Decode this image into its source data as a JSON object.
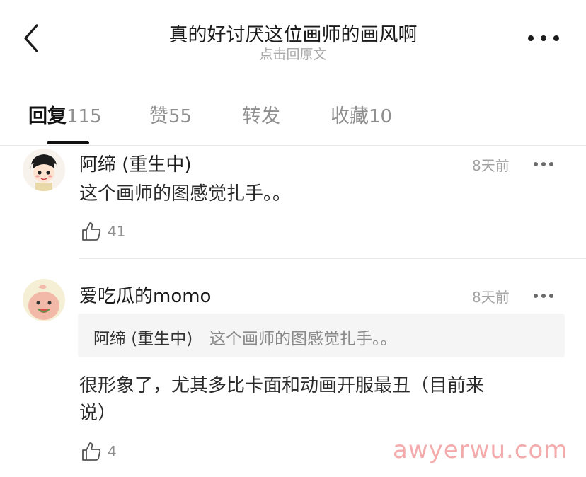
{
  "header": {
    "title": "真的好讨厌这位画师的画风啊",
    "subtitle": "点击回原文",
    "back_icon": "chevron-left-icon",
    "more_icon": "more-horizontal-icon"
  },
  "tabs": [
    {
      "label": "回复",
      "count": "115",
      "active": true
    },
    {
      "label": "赞",
      "count": "55",
      "active": false
    },
    {
      "label": "转发",
      "count": "",
      "active": false
    },
    {
      "label": "收藏",
      "count": "10",
      "active": false
    }
  ],
  "comments": [
    {
      "author": "阿缔 (重生中)",
      "time": "8天前",
      "text": "这个画师的图感觉扎手。。",
      "likes": "41"
    },
    {
      "author": "爱吃瓜的momo",
      "time": "8天前",
      "quote_author": "阿缔 (重生中)",
      "quote_text": "这个画师的图感觉扎手。。",
      "text_line1": "很形象了，尤其多比卡面和动画开服最丑（目前来",
      "text_line2": "说）",
      "likes": "4"
    }
  ],
  "watermark": "awyerwu.com",
  "colors": {
    "accent": "#111111",
    "muted": "#a2a2a2",
    "quote_bg": "#f5f5f5",
    "watermark": "#f2a3a3"
  }
}
